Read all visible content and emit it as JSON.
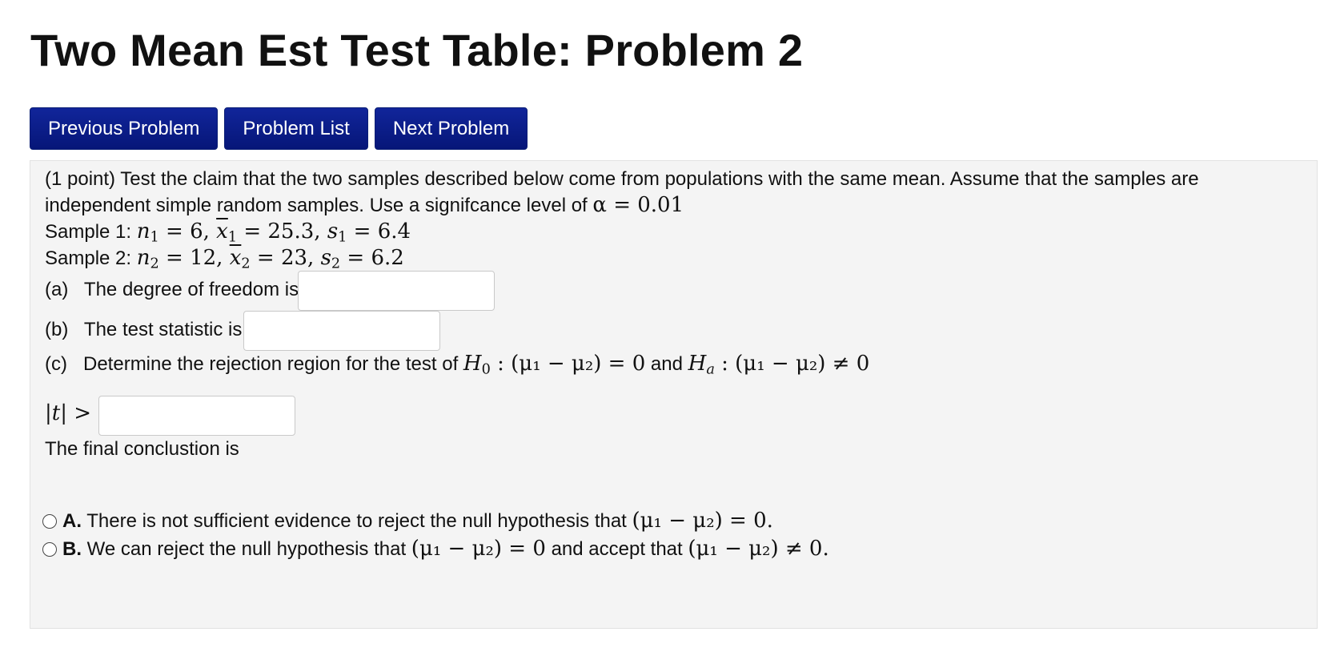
{
  "page": {
    "title": "Two Mean Est Test Table: Problem 2"
  },
  "nav": {
    "previous_label": "Previous Problem",
    "list_label": "Problem List",
    "next_label": "Next Problem"
  },
  "problem": {
    "intro_line1": "(1 point) Test the claim that the two samples described below come from populations with the same mean. Assume that the samples are",
    "intro_line2": "independent simple random samples. Use a signifcance level of ",
    "alpha_math": "α = 0.01",
    "sample1_label": "Sample 1: ",
    "sample1": {
      "n": "6",
      "xbar": "25.3",
      "s": "6.4"
    },
    "sample2_label": "Sample 2: ",
    "sample2": {
      "n": "12",
      "xbar": "23",
      "s": "6.2"
    },
    "part_a_label": "(a)",
    "part_a_text": "The degree of freedom is",
    "part_a_value": "",
    "part_b_label": "(b)",
    "part_b_text": "The test statistic is",
    "part_b_value": "",
    "part_c_label": "(c)",
    "part_c_text": "Determine the rejection region for the test of ",
    "h0_math": ": (μ₁ − μ₂) = 0",
    "and_text": " and ",
    "ha_math": ": (μ₁ − μ₂) ≠ 0",
    "t_region_math": "|t| >",
    "t_region_value": "",
    "final_text": "The final conclustion is",
    "choices": [
      {
        "letter": "A.",
        "text": "There is not sufficient evidence to reject the null hypothesis that ",
        "math": "(μ₁ − μ₂) = 0."
      },
      {
        "letter": "B.",
        "text": "We can reject the null hypothesis that ",
        "math": "(μ₁ − μ₂) = 0",
        "text2": " and accept that ",
        "math2": "(μ₁ − μ₂) ≠ 0."
      }
    ]
  }
}
